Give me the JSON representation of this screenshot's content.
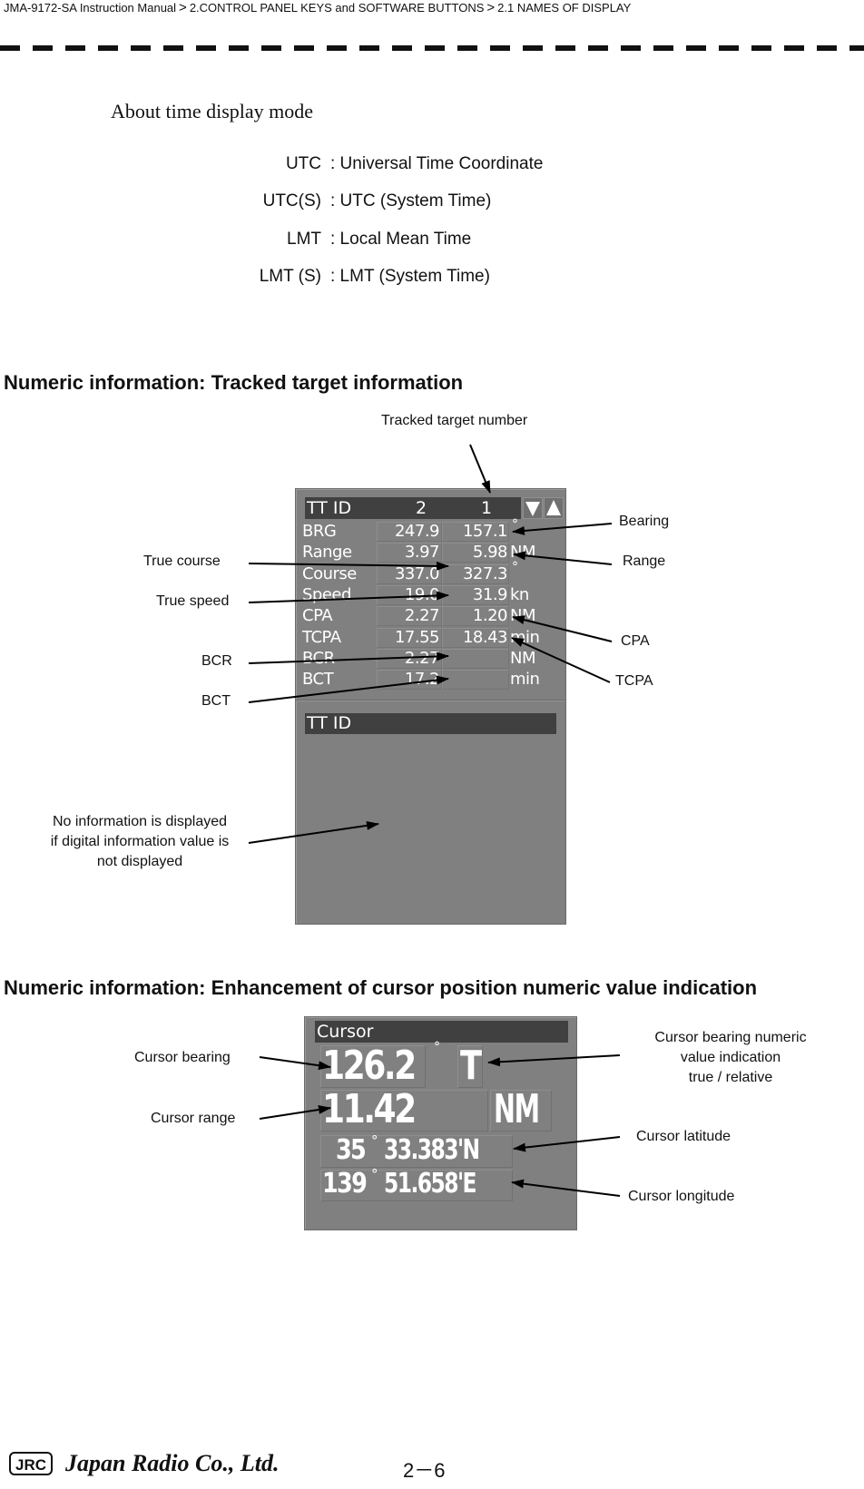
{
  "header": {
    "breadcrumb": [
      "JMA-9172-SA Instruction Manual",
      "2.CONTROL PANEL KEYS and SOFTWARE BUTTONS",
      "2.1  NAMES OF DISPLAY"
    ],
    "separator": ">"
  },
  "time_mode": {
    "heading": "About time display mode",
    "rows": [
      {
        "key": "UTC",
        "desc": ": Universal Time Coordinate"
      },
      {
        "key": "UTC(S)",
        "desc": ": UTC (System Time)"
      },
      {
        "key": "LMT",
        "desc": ": Local Mean Time"
      },
      {
        "key": "LMT (S)",
        "desc": ": LMT (System Time)"
      }
    ]
  },
  "tracked_target": {
    "heading": "Numeric information: Tracked target information",
    "panel": {
      "title": "TT  ID",
      "ids": [
        "2",
        "1"
      ],
      "scroll_down_icon": "triangle-down-icon",
      "scroll_up_icon": "triangle-up-icon",
      "rows": [
        {
          "label": "BRG",
          "v1": "247.9",
          "v2": "157.1",
          "unit": "°"
        },
        {
          "label": "Range",
          "v1": "3.97",
          "v2": "5.98",
          "unit": "NM"
        },
        {
          "label": "Course",
          "v1": "337.0",
          "v2": "327.3",
          "unit": "°"
        },
        {
          "label": "Speed",
          "v1": "19.0",
          "v2": "31.9",
          "unit": "kn"
        },
        {
          "label": "CPA",
          "v1": "2.27",
          "v2": "1.20",
          "unit": "NM"
        },
        {
          "label": "TCPA",
          "v1": "17.55",
          "v2": "18.43",
          "unit": "min"
        },
        {
          "label": "BCR",
          "v1": "2.27",
          "v2": "",
          "unit": "NM"
        },
        {
          "label": "BCT",
          "v1": "17.2",
          "v2": "",
          "unit": "min"
        }
      ],
      "second_title": "TT  ID"
    },
    "callouts": {
      "tracked_target_number": "Tracked target number",
      "bearing": "Bearing",
      "range": "Range",
      "cpa": "CPA",
      "tcpa": "TCPA",
      "true_course": "True course",
      "true_speed": "True speed",
      "bcr": "BCR",
      "bct": "BCT",
      "no_info": [
        "No information is displayed",
        "if digital information value is",
        "not displayed"
      ]
    }
  },
  "cursor": {
    "heading": "Numeric information: Enhancement of cursor position numeric value indication",
    "panel": {
      "title": "Cursor",
      "bearing": "126.2",
      "bearing_unit": "°",
      "bearing_mode": "T",
      "range": "11.42",
      "range_unit": "NM",
      "latitude_deg": "35",
      "latitude_min": "33.383'N",
      "longitude_deg": "139",
      "longitude_min": "51.658'E",
      "degree_sign": "°"
    },
    "callouts": {
      "cursor_bearing": "Cursor bearing",
      "cursor_range": "Cursor range",
      "bearing_mode": [
        "Cursor bearing numeric",
        "value indication",
        "true / relative"
      ],
      "cursor_latitude": "Cursor latitude",
      "cursor_longitude": "Cursor longitude"
    }
  },
  "footer": {
    "logo": "JRC",
    "company": "Japan Radio Co., Ltd.",
    "page": "2－6"
  }
}
